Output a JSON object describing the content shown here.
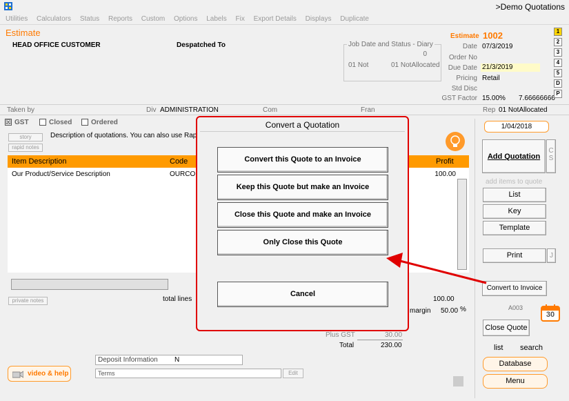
{
  "window": {
    "title": ">Demo Quotations"
  },
  "menu": [
    "Utilities",
    "Calculators",
    "Status",
    "Reports",
    "Custom",
    "Options",
    "Labels",
    "Fix",
    "Export Details",
    "Displays",
    "Duplicate"
  ],
  "header": {
    "doc_type": "Estimate",
    "customer": "HEAD OFFICE CUSTOMER",
    "despatched_to": "Despatched To",
    "diary_legend": "Job Date and Status - Diary",
    "diary_count": "0",
    "diary_not": "01 Not",
    "diary_status": "01 NotAllocated",
    "estimate_label": "Estimate",
    "estimate_no": "1002",
    "date_label": "Date",
    "date_value": "07/3/2019",
    "order_no_label": "Order No",
    "due_date_label": "Due Date",
    "due_date_value": "21/3/2019",
    "pricing_label": "Pricing",
    "pricing_value": "Retail",
    "std_disc_label": "Std Disc",
    "gst_factor_label": "GST Factor",
    "gst_factor_value": "15.00%",
    "gst_factor_extra": "7.66666666",
    "tabs": [
      "1",
      "2",
      "3",
      "4",
      "5",
      "D",
      "P"
    ]
  },
  "info_row": {
    "taken_by": "Taken by",
    "div_label": "Div",
    "div_value": "ADMINISTRATION",
    "com_label": "Com",
    "fran_label": "Fran",
    "rep_label": "Rep",
    "rep_value": "01 NotAllocated"
  },
  "checks": {
    "gst": "GST",
    "closed": "Closed",
    "ordered": "Ordered"
  },
  "left": {
    "story_btn": "story",
    "rapid_notes_btn": "rapid notes",
    "description_text": "Description of quotations. You can also use Rap",
    "table_headers": {
      "item": "Item Description",
      "code": "Code",
      "profit": "Profit"
    },
    "row": {
      "item": "Our Product/Service Description",
      "code": "OURCO",
      "profit": "100.00"
    },
    "private_notes_btn": "private notes",
    "total_lines": "total lines",
    "totals_value": "100.00",
    "margin_label": "margin",
    "margin_value": "50.00",
    "margin_unit": "%",
    "plus_gst_label": "Plus GST",
    "plus_gst_value": "30.00",
    "total_label": "Total",
    "total_value": "230.00",
    "deposit_label": "Deposit Information",
    "deposit_value": "N",
    "terms_placeholder": "Terms",
    "edit_btn": "Edit",
    "video_help": "video & help"
  },
  "right": {
    "date_box": "1/04/2018",
    "add_quotation": "Add Quotation",
    "cs": "C S",
    "add_items_hint": "add items to quote",
    "list_btn": "List",
    "key_btn": "Key",
    "template_btn": "Template",
    "print_btn": "Print",
    "j_btn": "J",
    "convert_btn": "Convert to Invoice",
    "code": "A003",
    "calendar_day": "30",
    "close_quote_btn": "Close Quote",
    "list_link": "list",
    "search_link": "search",
    "database_btn": "Database",
    "menu_btn": "Menu"
  },
  "modal": {
    "title": "Convert a Quotation",
    "opt1": "Convert this Quote to an Invoice",
    "opt2": "Keep this Quote but make an Invoice",
    "opt3": "Close this Quote and make an Invoice",
    "opt4": "Only Close this Quote",
    "cancel": "Cancel"
  },
  "colors": {
    "accent": "#ff9a00",
    "highlight": "#fffbc8",
    "annotation": "#e00000"
  }
}
